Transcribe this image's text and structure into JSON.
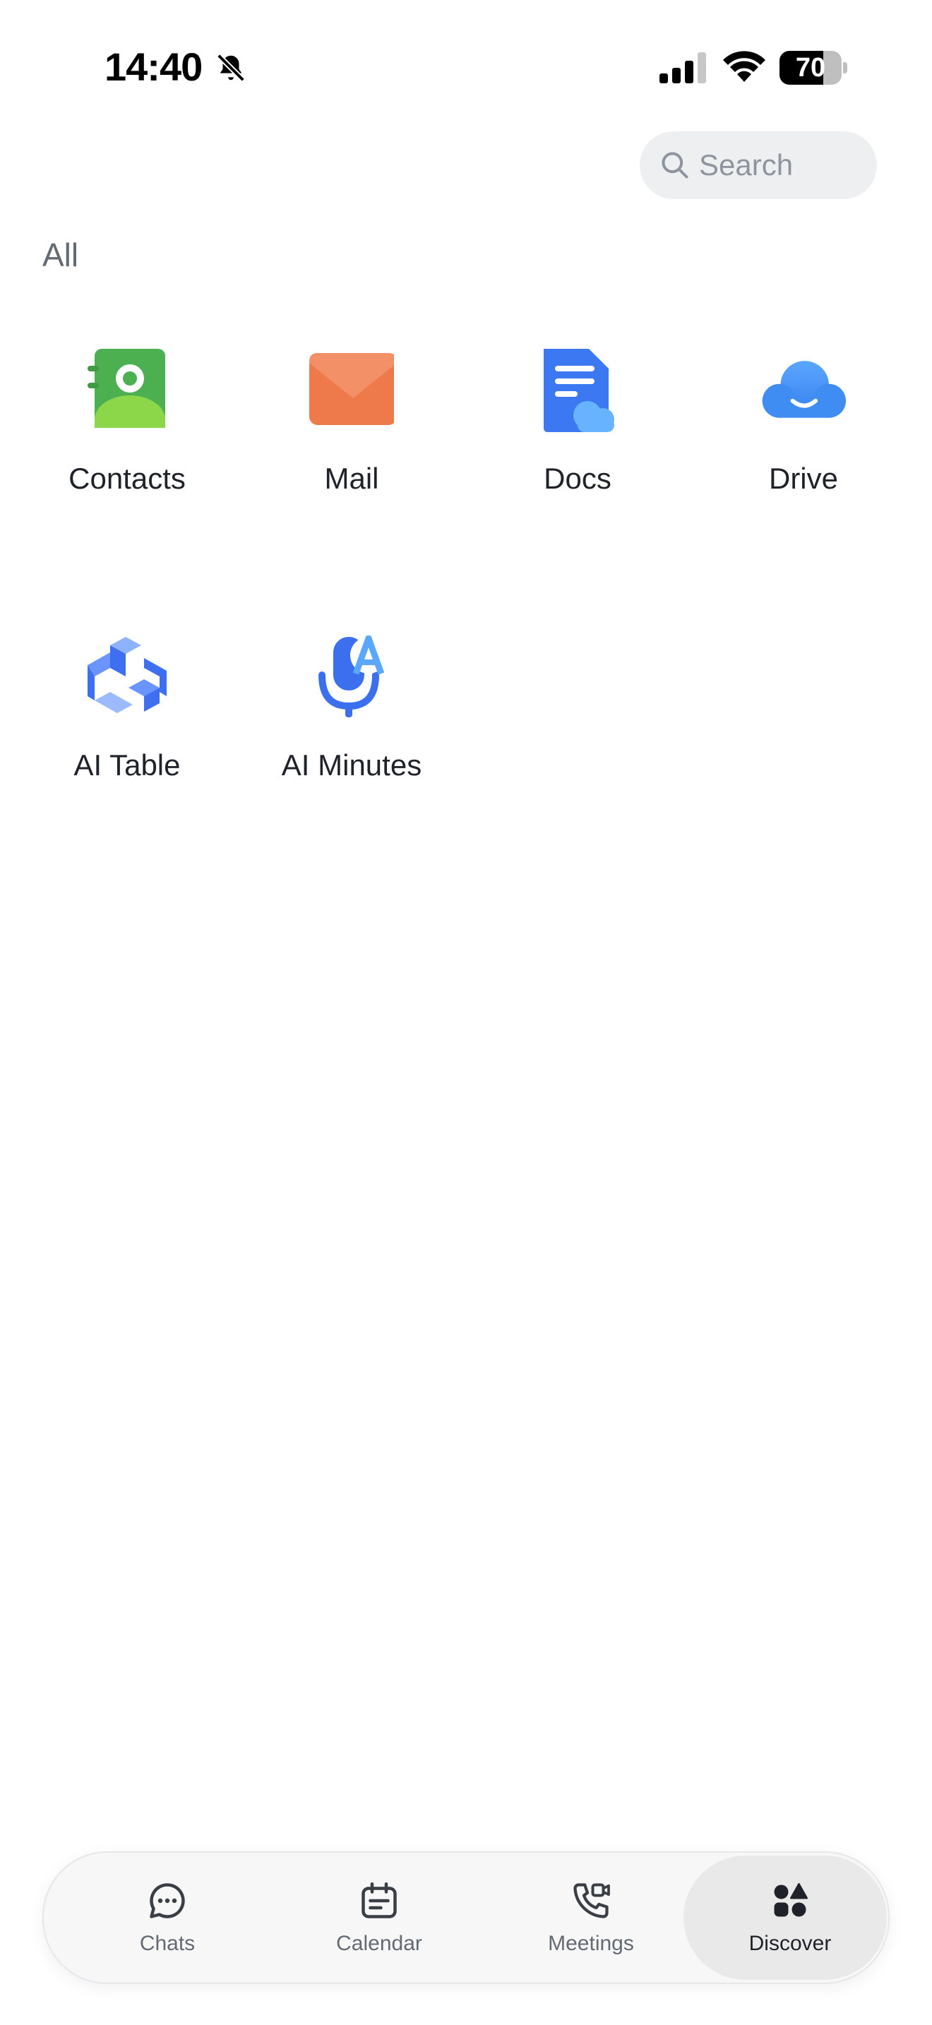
{
  "status_bar": {
    "time": "14:40",
    "battery_level": "70",
    "battery_fraction": 0.7
  },
  "search": {
    "placeholder": "Search"
  },
  "section": {
    "title": "All"
  },
  "apps": [
    {
      "label": "Contacts",
      "icon": "contacts-icon"
    },
    {
      "label": "Mail",
      "icon": "mail-icon"
    },
    {
      "label": "Docs",
      "icon": "docs-icon"
    },
    {
      "label": "Drive",
      "icon": "drive-icon"
    },
    {
      "label": "AI Table",
      "icon": "ai-table-icon"
    },
    {
      "label": "AI Minutes",
      "icon": "ai-minutes-icon"
    }
  ],
  "tab_bar": {
    "tabs": [
      {
        "label": "Chats",
        "icon": "chat-bubble-icon"
      },
      {
        "label": "Calendar",
        "icon": "calendar-icon"
      },
      {
        "label": "Meetings",
        "icon": "video-phone-icon"
      },
      {
        "label": "Discover",
        "icon": "shapes-icon"
      }
    ],
    "active": "Discover"
  }
}
